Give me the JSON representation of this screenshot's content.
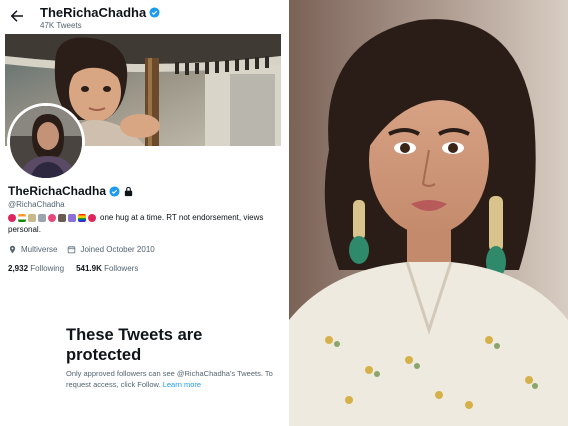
{
  "header": {
    "display_name": "TheRichaChadha",
    "tweet_count": "47K Tweets"
  },
  "profile": {
    "display_name": "TheRichaChadha",
    "handle": "@RichaChadha",
    "bio_text": "one hug at a time. RT not endorsement, views",
    "bio_text_2": "personal.",
    "location": "Multiverse",
    "joined": "Joined October 2010",
    "following_count": "2,932",
    "following_label": "Following",
    "followers_count": "541.9K",
    "followers_label": "Followers"
  },
  "protected": {
    "title": "These Tweets are protected",
    "description": "Only approved followers can see @RichaChadha's Tweets. To request access, click Follow.",
    "learn_more": "Learn more"
  },
  "icons": [
    "back-arrow-icon",
    "verified-badge-icon",
    "lock-icon",
    "location-icon",
    "calendar-icon"
  ],
  "colors": {
    "accent": "#1d9bf0",
    "text": "#0f1419",
    "muted": "#536471"
  }
}
